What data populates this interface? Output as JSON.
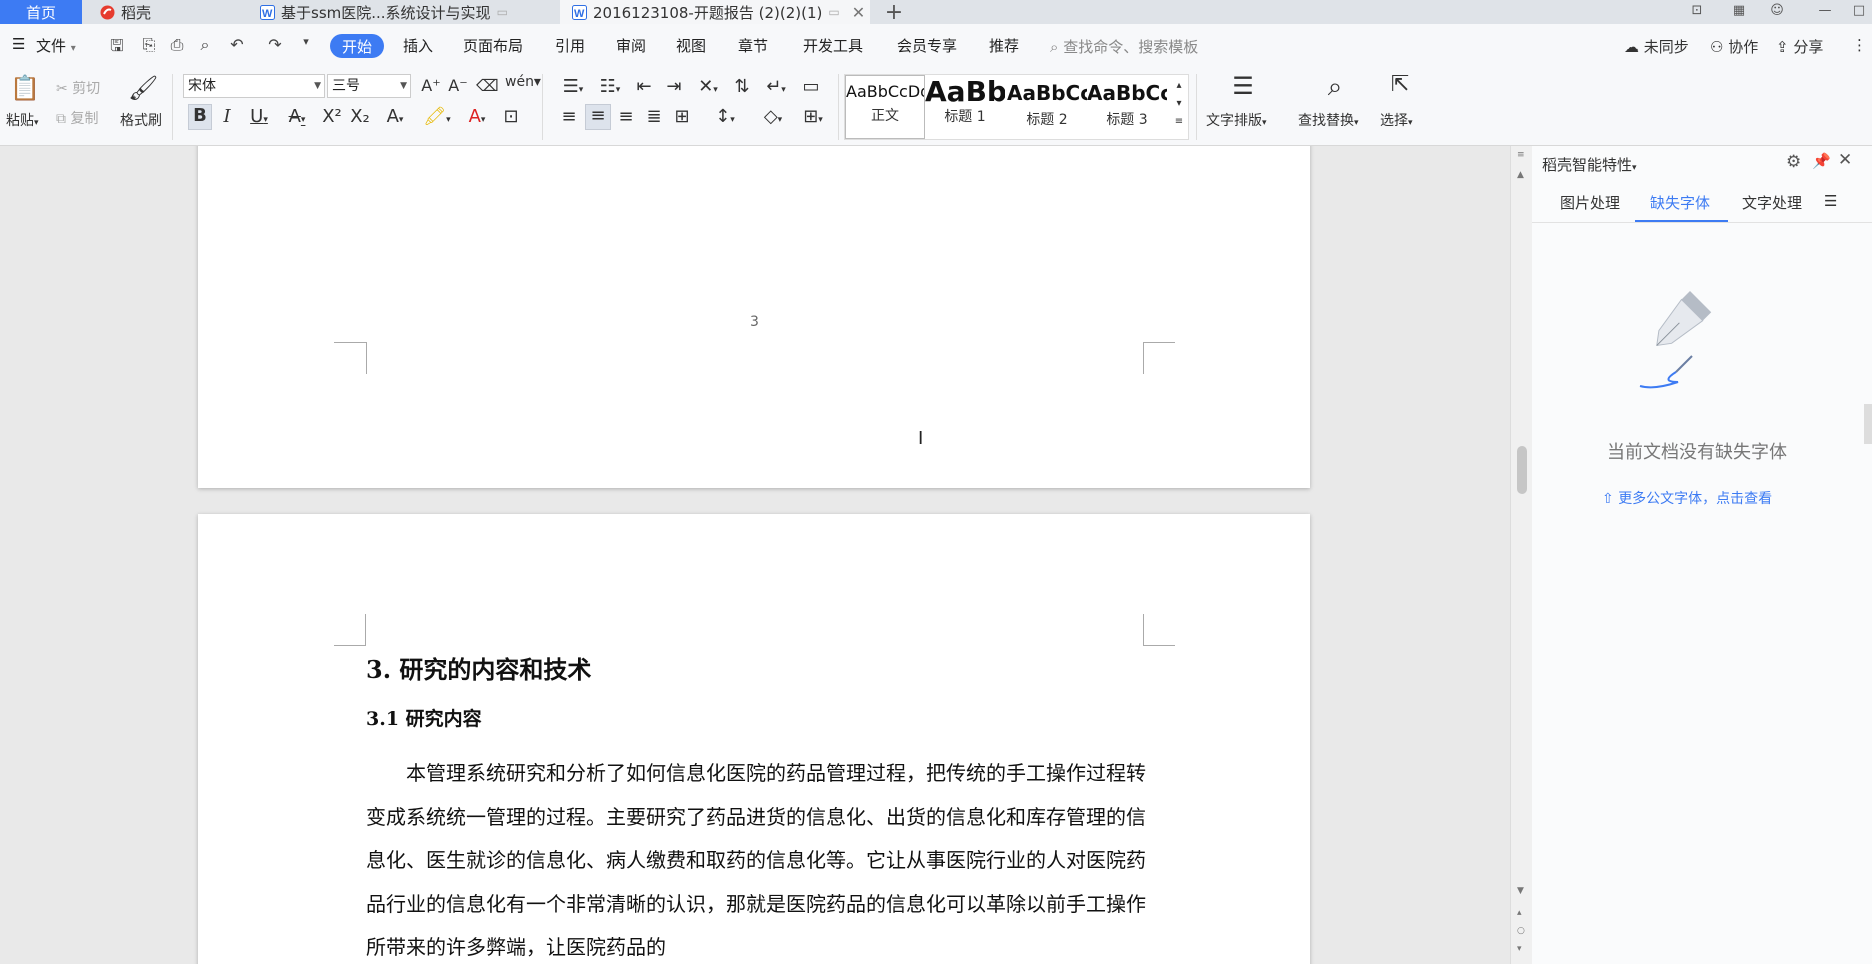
{
  "tabs": {
    "home": "首页",
    "daoke": "稻壳",
    "doc1": "基于ssm医院...系统设计与实现",
    "doc2": "2016123108-开题报告 (2)(2)(1)"
  },
  "menu": {
    "file": "文件",
    "start": "开始",
    "insert": "插入",
    "layout": "页面布局",
    "reference": "引用",
    "review": "审阅",
    "view": "视图",
    "chapter": "章节",
    "devtools": "开发工具",
    "member": "会员专享",
    "recommend": "推荐",
    "search_placeholder": "查找命令、搜索模板",
    "unsynced": "未同步",
    "collab": "协作",
    "share": "分享"
  },
  "ribbon": {
    "paste": "粘贴",
    "cut": "剪切",
    "copy": "复制",
    "format_painter": "格式刷",
    "font_name": "宋体",
    "font_size": "三号",
    "styles": [
      {
        "preview": "AaBbCcDd",
        "name": "正文"
      },
      {
        "preview": "AaBb",
        "name": "标题 1"
      },
      {
        "preview": "AaBbCc",
        "name": "标题 2"
      },
      {
        "preview": "AaBbCc",
        "name": "标题 3"
      }
    ],
    "text_layout": "文字排版",
    "find_replace": "查找替换",
    "select": "选择"
  },
  "document": {
    "page_number": "3",
    "heading1": "3. 研究的内容和技术",
    "heading2": "3.1  研究内容",
    "paragraph": "本管理系统研究和分析了如何信息化医院的药品管理过程，把传统的手工操作过程转变成系统统一管理的过程。主要研究了药品进货的信息化、出货的信息化和库存管理的信息化、医生就诊的信息化、病人缴费和取药的信息化等。它让从事医院行业的人对医院药品行业的信息化有一个非常清晰的认识，那就是医院药品的信息化可以革除以前手工操作所带来的许多弊端，让医院药品的"
  },
  "panel": {
    "title": "稻壳智能特性",
    "tabs": [
      "图片处理",
      "缺失字体",
      "文字处理"
    ],
    "empty_message": "当前文档没有缺失字体",
    "more_link": "更多公文字体，点击查看"
  },
  "colors": {
    "accent": "#3d7bf3"
  }
}
